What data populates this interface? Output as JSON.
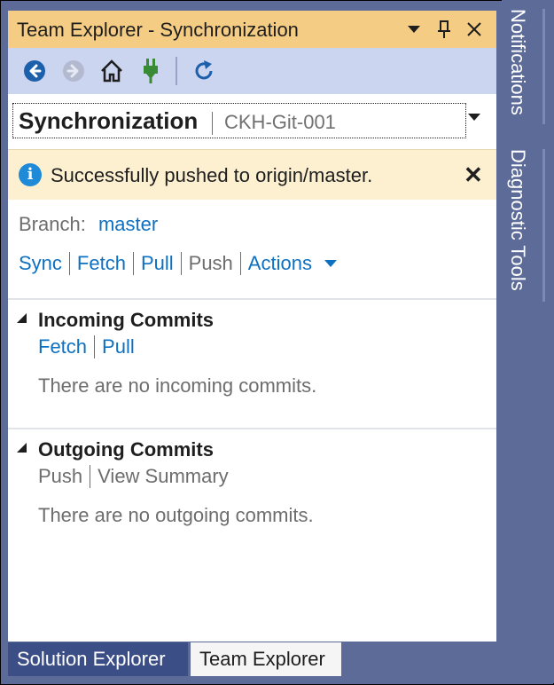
{
  "window": {
    "title": "Team Explorer - Synchronization",
    "title_icons": [
      "dropdown-icon",
      "pin-icon",
      "close-icon"
    ]
  },
  "toolbar": {
    "buttons": [
      "back-icon",
      "forward-icon",
      "home-icon",
      "connect-icon",
      "refresh-icon"
    ]
  },
  "page": {
    "title": "Synchronization",
    "subtitle": "CKH-Git-001"
  },
  "notification": {
    "icon": "info-icon",
    "message": "Successfully pushed to origin/master.",
    "close_label": "✕"
  },
  "branch": {
    "label": "Branch:",
    "value": "master"
  },
  "actions": {
    "sync": "Sync",
    "fetch": "Fetch",
    "pull": "Pull",
    "push": "Push",
    "actions": "Actions"
  },
  "incoming": {
    "title": "Incoming Commits",
    "links": {
      "fetch": "Fetch",
      "pull": "Pull"
    },
    "empty": "There are no incoming commits."
  },
  "outgoing": {
    "title": "Outgoing Commits",
    "links": {
      "push": "Push",
      "view_summary": "View Summary"
    },
    "empty": "There are no outgoing commits."
  },
  "tabs": {
    "solution_explorer": "Solution Explorer",
    "team_explorer": "Team Explorer"
  },
  "side_tabs": {
    "notifications": "Notifications",
    "diagnostic_tools": "Diagnostic Tools"
  },
  "colors": {
    "title_bar": "#f5cc84",
    "toolbar": "#ccd5f0",
    "link": "#0e70c0",
    "info_bar": "#fdf0d0",
    "dock_bg": "#5d6b99"
  }
}
